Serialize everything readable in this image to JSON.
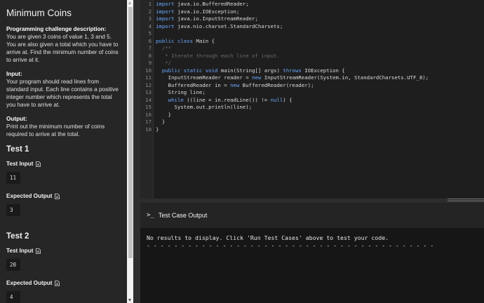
{
  "problem": {
    "title": "Minimum Coins",
    "description_heading": "Programming challenge description:",
    "description_text": "You are given 3 coins of value 1, 3 and 5. You are also given a total which you have to arrive at. Find the minimum number of coins to arrive at it.",
    "input_heading": "Input:",
    "input_text": "Your program should read lines from standard input. Each line contains a positive integer number which represents the total you have to arrive at.",
    "output_heading": "Output:",
    "output_text": "Print out the minimum number of coins required to arrive at the total."
  },
  "tests": [
    {
      "title": "Test 1",
      "input_label": "Test Input",
      "input_value": "11",
      "expected_label": "Expected Output",
      "expected_value": "3"
    },
    {
      "title": "Test 2",
      "input_label": "Test Input",
      "input_value": "20",
      "expected_label": "Expected Output",
      "expected_value": "4"
    }
  ],
  "editor": {
    "line_numbers": [
      "1",
      "2",
      "3",
      "4",
      "5",
      "6",
      "7",
      "8",
      "9",
      "10",
      "11",
      "12",
      "13",
      "14",
      "15",
      "16",
      "17",
      "18"
    ],
    "lines": [
      [
        {
          "t": "import",
          "c": "kw"
        },
        {
          "t": " java.io.BufferedReader;",
          "c": "ty"
        }
      ],
      [
        {
          "t": "import",
          "c": "kw"
        },
        {
          "t": " java.io.IOException;",
          "c": "ty"
        }
      ],
      [
        {
          "t": "import",
          "c": "kw"
        },
        {
          "t": " java.io.InputStreamReader;",
          "c": "ty"
        }
      ],
      [
        {
          "t": "import",
          "c": "kw"
        },
        {
          "t": " java.nio.charset.StandardCharsets;",
          "c": "ty"
        }
      ],
      [
        {
          "t": "",
          "c": "ty"
        }
      ],
      [
        {
          "t": "public class",
          "c": "kw"
        },
        {
          "t": " Main {",
          "c": "ty"
        }
      ],
      [
        {
          "t": "  /**",
          "c": "cm"
        }
      ],
      [
        {
          "t": "   * Iterate through each line of input.",
          "c": "cm"
        }
      ],
      [
        {
          "t": "   */",
          "c": "cm"
        }
      ],
      [
        {
          "t": "  public static void",
          "c": "kw"
        },
        {
          "t": " main(String[] args) ",
          "c": "ty"
        },
        {
          "t": "throws",
          "c": "kw"
        },
        {
          "t": " IOException {",
          "c": "ty"
        }
      ],
      [
        {
          "t": "    InputStreamReader reader = ",
          "c": "ty"
        },
        {
          "t": "new",
          "c": "kw"
        },
        {
          "t": " InputStreamReader(System.in, StandardCharsets.UTF_8);",
          "c": "ty"
        }
      ],
      [
        {
          "t": "    BufferedReader in = ",
          "c": "ty"
        },
        {
          "t": "new",
          "c": "kw"
        },
        {
          "t": " BufferedReader(reader);",
          "c": "ty"
        }
      ],
      [
        {
          "t": "    String line;",
          "c": "ty"
        }
      ],
      [
        {
          "t": "    while",
          "c": "kw"
        },
        {
          "t": " ((line = in.readLine()) != ",
          "c": "ty"
        },
        {
          "t": "null",
          "c": "kw"
        },
        {
          "t": ") {",
          "c": "ty"
        }
      ],
      [
        {
          "t": "      System.out.println(line);",
          "c": "ty"
        }
      ],
      [
        {
          "t": "    }",
          "c": "ty"
        }
      ],
      [
        {
          "t": "  }",
          "c": "ty"
        }
      ],
      [
        {
          "t": "}",
          "c": "ty"
        }
      ]
    ]
  },
  "output_panel": {
    "icon_text": ">_",
    "title": "Test Case Output",
    "message": "No results to display. Click 'Run Test Cases' above to test your code.",
    "dash_line": "- - - - - - - - - - - - - - - - - - - - - - - - - - - - - - - - - - - - - - - - - -"
  },
  "colors": {
    "keyword": "#6aa7ff",
    "comment": "#6a6a6a",
    "background": "#1e1e1e"
  },
  "icons": [
    "document-icon",
    "terminal-prompt-icon"
  ]
}
